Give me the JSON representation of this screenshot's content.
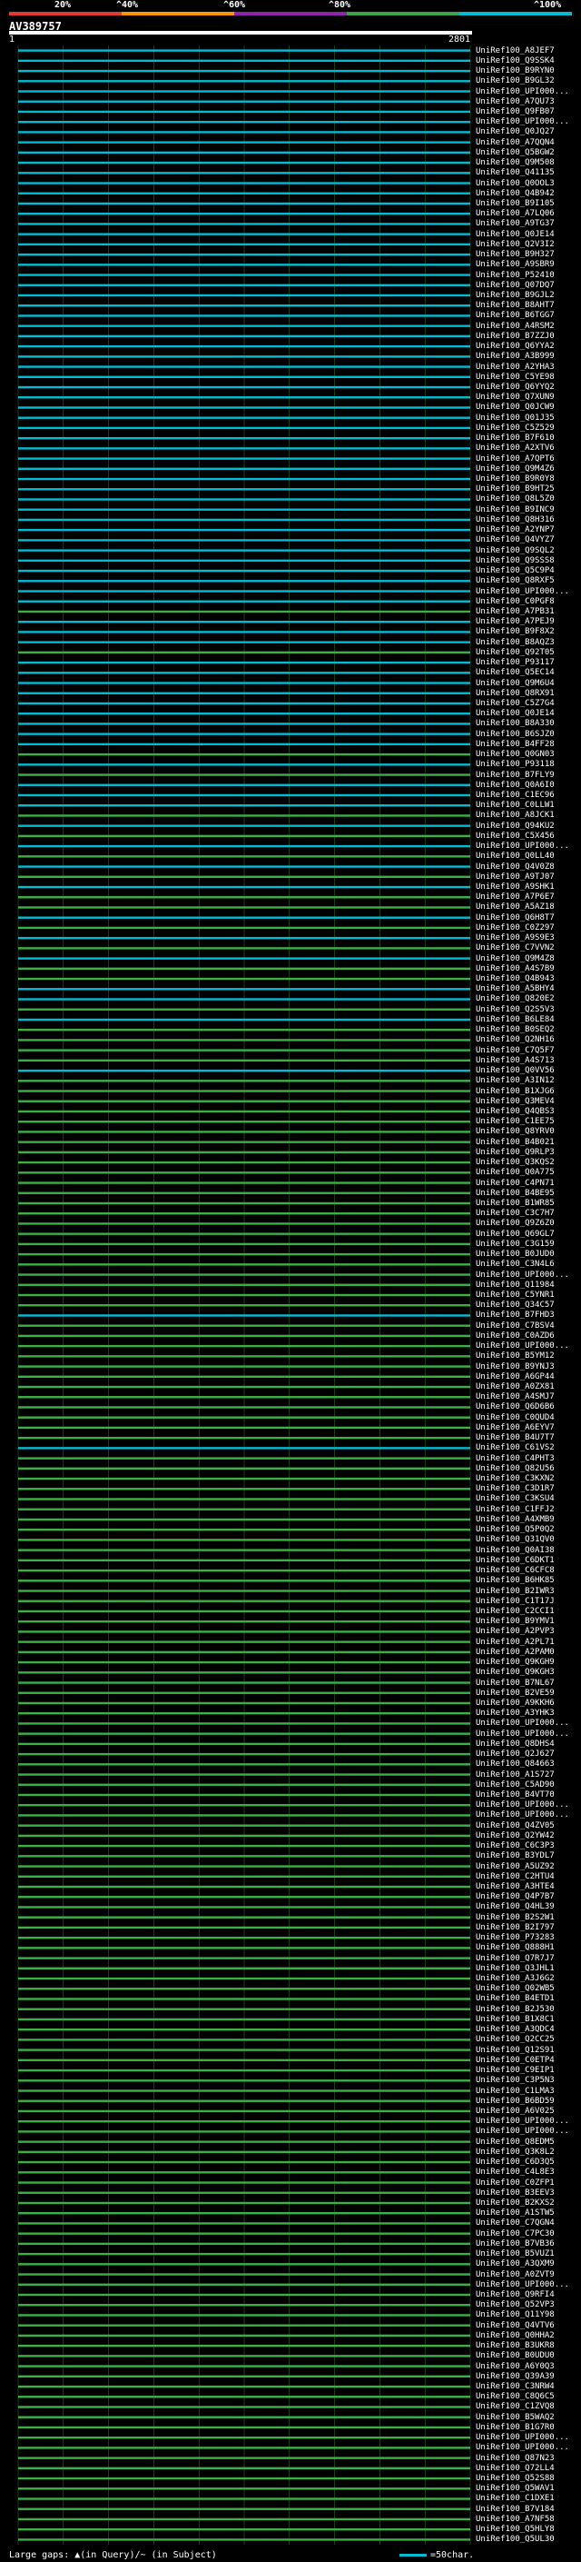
{
  "header": {
    "percent_labels": [
      "20%",
      "^40%",
      "^60%",
      "^80%",
      "^100%"
    ],
    "bands": [
      {
        "color": "#e53935"
      },
      {
        "color": "#ff9800"
      },
      {
        "color": "#8e24aa"
      },
      {
        "color": "#43a047"
      },
      {
        "color": "#00bcd4"
      }
    ]
  },
  "query": {
    "name": "AV389757",
    "start": "1",
    "end": "2801"
  },
  "footer": {
    "gaps_text": "Large gaps: ▲(in Query)/~ (in Subject)",
    "scale_text": "=50char."
  },
  "colors": {
    "cyan": "#00bcd4",
    "green": "#3cb043",
    "grid": "#2e7d32"
  },
  "chart_data": {
    "type": "alignment",
    "x_range": [
      1,
      2801
    ],
    "hits": [
      {
        "name": "UniRef100_A8JEF7",
        "cls": "c"
      },
      {
        "name": "UniRef100_Q9SSK4",
        "cls": "c"
      },
      {
        "name": "UniRef100_B9RYN0",
        "cls": "c"
      },
      {
        "name": "UniRef100_B9GL32",
        "cls": "c"
      },
      {
        "name": "UniRef100_UPI000...",
        "cls": "c"
      },
      {
        "name": "UniRef100_A7QU73",
        "cls": "c"
      },
      {
        "name": "UniRef100_Q9FB07",
        "cls": "c"
      },
      {
        "name": "UniRef100_UPI000...",
        "cls": "c"
      },
      {
        "name": "UniRef100_Q0JQ27",
        "cls": "c"
      },
      {
        "name": "UniRef100_A7QQN4",
        "cls": "c"
      },
      {
        "name": "UniRef100_Q5BGW2",
        "cls": "c"
      },
      {
        "name": "UniRef100_Q9M508",
        "cls": "c"
      },
      {
        "name": "UniRef100_Q41135",
        "cls": "c"
      },
      {
        "name": "UniRef100_Q0OOL3",
        "cls": "c"
      },
      {
        "name": "UniRef100_Q4B942",
        "cls": "c"
      },
      {
        "name": "UniRef100_B9I105",
        "cls": "c"
      },
      {
        "name": "UniRef100_A7LQ06",
        "cls": "c"
      },
      {
        "name": "UniRef100_A9TG37",
        "cls": "c"
      },
      {
        "name": "UniRef100_Q0JE14",
        "cls": "c"
      },
      {
        "name": "UniRef100_Q2V3I2",
        "cls": "c"
      },
      {
        "name": "UniRef100_B9H327",
        "cls": "c"
      },
      {
        "name": "UniRef100_A9SBR9",
        "cls": "c"
      },
      {
        "name": "UniRef100_P52410",
        "cls": "c"
      },
      {
        "name": "UniRef100_Q07DQ7",
        "cls": "c"
      },
      {
        "name": "UniRef100_B9GJL2",
        "cls": "c"
      },
      {
        "name": "UniRef100_B8AHT7",
        "cls": "c"
      },
      {
        "name": "UniRef100_B6TGG7",
        "cls": "c"
      },
      {
        "name": "UniRef100_A4RSM2",
        "cls": "c"
      },
      {
        "name": "UniRef100_B7ZZJ0",
        "cls": "c"
      },
      {
        "name": "UniRef100_Q6YYA2",
        "cls": "c"
      },
      {
        "name": "UniRef100_A3B999",
        "cls": "c"
      },
      {
        "name": "UniRef100_A2YHA3",
        "cls": "c"
      },
      {
        "name": "UniRef100_C5YE98",
        "cls": "c"
      },
      {
        "name": "UniRef100_Q6YYQ2",
        "cls": "c"
      },
      {
        "name": "UniRef100_Q7XUN9",
        "cls": "c"
      },
      {
        "name": "UniRef100_Q0JCW9",
        "cls": "c"
      },
      {
        "name": "UniRef100_Q01J35",
        "cls": "c"
      },
      {
        "name": "UniRef100_C5Z529",
        "cls": "c"
      },
      {
        "name": "UniRef100_B7F610",
        "cls": "c"
      },
      {
        "name": "UniRef100_A2XTV6",
        "cls": "c"
      },
      {
        "name": "UniRef100_A7QPT6",
        "cls": "c"
      },
      {
        "name": "UniRef100_Q9M4Z6",
        "cls": "c"
      },
      {
        "name": "UniRef100_B9R0Y8",
        "cls": "c"
      },
      {
        "name": "UniRef100_B9HT25",
        "cls": "c"
      },
      {
        "name": "UniRef100_Q8L5Z0",
        "cls": "c"
      },
      {
        "name": "UniRef100_B9INC9",
        "cls": "c"
      },
      {
        "name": "UniRef100_Q8H316",
        "cls": "c"
      },
      {
        "name": "UniRef100_A2YNP7",
        "cls": "c"
      },
      {
        "name": "UniRef100_Q4VYZ7",
        "cls": "c"
      },
      {
        "name": "UniRef100_Q9SQL2",
        "cls": "c"
      },
      {
        "name": "UniRef100_Q9SSS8",
        "cls": "c"
      },
      {
        "name": "UniRef100_Q5C9P4",
        "cls": "c"
      },
      {
        "name": "UniRef100_Q8RXF5",
        "cls": "c"
      },
      {
        "name": "UniRef100_UPI000...",
        "cls": "c"
      },
      {
        "name": "UniRef100_C0PGF8",
        "cls": "c"
      },
      {
        "name": "UniRef100_A7PB31",
        "cls": "g"
      },
      {
        "name": "UniRef100_A7PEJ9",
        "cls": "c"
      },
      {
        "name": "UniRef100_B9F8X2",
        "cls": "c"
      },
      {
        "name": "UniRef100_B8AQZ3",
        "cls": "c"
      },
      {
        "name": "UniRef100_Q92T05",
        "cls": "g"
      },
      {
        "name": "UniRef100_P93117",
        "cls": "c"
      },
      {
        "name": "UniRef100_Q5EC14",
        "cls": "c"
      },
      {
        "name": "UniRef100_Q9M6U4",
        "cls": "c"
      },
      {
        "name": "UniRef100_Q8RX91",
        "cls": "c"
      },
      {
        "name": "UniRef100_C5Z7G4",
        "cls": "c"
      },
      {
        "name": "UniRef100_Q0JE14",
        "cls": "c"
      },
      {
        "name": "UniRef100_B8A330",
        "cls": "c"
      },
      {
        "name": "UniRef100_B6SJZ0",
        "cls": "c"
      },
      {
        "name": "UniRef100_B4FF28",
        "cls": "c"
      },
      {
        "name": "UniRef100_Q0GN03",
        "cls": "g"
      },
      {
        "name": "UniRef100_P93118",
        "cls": "c"
      },
      {
        "name": "UniRef100_B7FLY9",
        "cls": "g"
      },
      {
        "name": "UniRef100_Q0A6I0",
        "cls": "c"
      },
      {
        "name": "UniRef100_C1EC96",
        "cls": "c"
      },
      {
        "name": "UniRef100_C0LLW1",
        "cls": "c"
      },
      {
        "name": "UniRef100_A8JCK1",
        "cls": "g"
      },
      {
        "name": "UniRef100_Q94KU2",
        "cls": "c"
      },
      {
        "name": "UniRef100_C5X456",
        "cls": "g"
      },
      {
        "name": "UniRef100_UPI000...",
        "cls": "c"
      },
      {
        "name": "UniRef100_Q0LL40",
        "cls": "g"
      },
      {
        "name": "UniRef100_Q4V0Z8",
        "cls": "c"
      },
      {
        "name": "UniRef100_A9TJ07",
        "cls": "g"
      },
      {
        "name": "UniRef100_A9SHK1",
        "cls": "c"
      },
      {
        "name": "UniRef100_A7P6E7",
        "cls": "g"
      },
      {
        "name": "UniRef100_A5AZ18",
        "cls": "g"
      },
      {
        "name": "UniRef100_Q6H8T7",
        "cls": "c"
      },
      {
        "name": "UniRef100_C0Z297",
        "cls": "g"
      },
      {
        "name": "UniRef100_A9S9E3",
        "cls": "c"
      },
      {
        "name": "UniRef100_C7VVN2",
        "cls": "g"
      },
      {
        "name": "UniRef100_Q9M4Z8",
        "cls": "c"
      },
      {
        "name": "UniRef100_A4S7B9",
        "cls": "g"
      },
      {
        "name": "UniRef100_Q4B943",
        "cls": "g"
      },
      {
        "name": "UniRef100_A5BHY4",
        "cls": "c"
      },
      {
        "name": "UniRef100_Q820E2",
        "cls": "c"
      },
      {
        "name": "UniRef100_Q2S5V3",
        "cls": "g"
      },
      {
        "name": "UniRef100_B6LE84",
        "cls": "c"
      },
      {
        "name": "UniRef100_B0SEQ2",
        "cls": "g"
      },
      {
        "name": "UniRef100_Q2NH16",
        "cls": "g"
      },
      {
        "name": "UniRef100_C7Q5F7",
        "cls": "g"
      },
      {
        "name": "UniRef100_A4S713",
        "cls": "g"
      },
      {
        "name": "UniRef100_Q0VV56",
        "cls": "c"
      },
      {
        "name": "UniRef100_A3IN12",
        "cls": "g"
      },
      {
        "name": "UniRef100_B1XJG6",
        "cls": "g"
      },
      {
        "name": "UniRef100_Q3MEV4",
        "cls": "g"
      },
      {
        "name": "UniRef100_Q4QBS3",
        "cls": "g"
      },
      {
        "name": "UniRef100_C1EE75",
        "cls": "g"
      },
      {
        "name": "UniRef100_Q8YRV0",
        "cls": "g"
      },
      {
        "name": "UniRef100_B4B021",
        "cls": "g"
      },
      {
        "name": "UniRef100_Q9RLP3",
        "cls": "g"
      },
      {
        "name": "UniRef100_Q3KQS2",
        "cls": "g"
      },
      {
        "name": "UniRef100_Q0A775",
        "cls": "g"
      },
      {
        "name": "UniRef100_C4PN71",
        "cls": "g"
      },
      {
        "name": "UniRef100_B4BE95",
        "cls": "g"
      },
      {
        "name": "UniRef100_B1WR85",
        "cls": "g"
      },
      {
        "name": "UniRef100_C3C7H7",
        "cls": "g"
      },
      {
        "name": "UniRef100_Q9Z6Z0",
        "cls": "g"
      },
      {
        "name": "UniRef100_Q69GL7",
        "cls": "g"
      },
      {
        "name": "UniRef100_C3G159",
        "cls": "g"
      },
      {
        "name": "UniRef100_B0JUD0",
        "cls": "g"
      },
      {
        "name": "UniRef100_C3N4L6",
        "cls": "g"
      },
      {
        "name": "UniRef100_UPI000...",
        "cls": "g"
      },
      {
        "name": "UniRef100_Q11984",
        "cls": "g"
      },
      {
        "name": "UniRef100_C5YNR1",
        "cls": "g"
      },
      {
        "name": "UniRef100_Q34C57",
        "cls": "g"
      },
      {
        "name": "UniRef100_B7FHD3",
        "cls": "c"
      },
      {
        "name": "UniRef100_C7BSV4",
        "cls": "g"
      },
      {
        "name": "UniRef100_C0AZD6",
        "cls": "g"
      },
      {
        "name": "UniRef100_UPI000...",
        "cls": "g"
      },
      {
        "name": "UniRef100_B5YM12",
        "cls": "g"
      },
      {
        "name": "UniRef100_B9YNJ3",
        "cls": "g"
      },
      {
        "name": "UniRef100_A6GP44",
        "cls": "g"
      },
      {
        "name": "UniRef100_A0ZX81",
        "cls": "g"
      },
      {
        "name": "UniRef100_A4SMJ7",
        "cls": "g"
      },
      {
        "name": "UniRef100_Q6D6B6",
        "cls": "g"
      },
      {
        "name": "UniRef100_C0QUD4",
        "cls": "g"
      },
      {
        "name": "UniRef100_A6EYV7",
        "cls": "g"
      },
      {
        "name": "UniRef100_B4U7T7",
        "cls": "g"
      },
      {
        "name": "UniRef100_C61VS2",
        "cls": "c"
      },
      {
        "name": "UniRef100_C4PHT3",
        "cls": "g"
      },
      {
        "name": "UniRef100_Q82U56",
        "cls": "g"
      },
      {
        "name": "UniRef100_C3KXN2",
        "cls": "g"
      },
      {
        "name": "UniRef100_C3D1R7",
        "cls": "g"
      },
      {
        "name": "UniRef100_C3KSU4",
        "cls": "g"
      },
      {
        "name": "UniRef100_C1FFJ2",
        "cls": "g"
      },
      {
        "name": "UniRef100_A4XMB9",
        "cls": "g"
      },
      {
        "name": "UniRef100_Q5P0Q2",
        "cls": "g"
      },
      {
        "name": "UniRef100_Q31QV0",
        "cls": "g"
      },
      {
        "name": "UniRef100_Q0AI38",
        "cls": "g"
      },
      {
        "name": "UniRef100_C6DKT1",
        "cls": "g"
      },
      {
        "name": "UniRef100_C6CFC8",
        "cls": "g"
      },
      {
        "name": "UniRef100_B6HK85",
        "cls": "g"
      },
      {
        "name": "UniRef100_B2IWR3",
        "cls": "g"
      },
      {
        "name": "UniRef100_C1T17J",
        "cls": "g"
      },
      {
        "name": "UniRef100_C2CCI1",
        "cls": "g"
      },
      {
        "name": "UniRef100_B9YMV1",
        "cls": "g"
      },
      {
        "name": "UniRef100_A2PVP3",
        "cls": "g"
      },
      {
        "name": "UniRef100_A2PL71",
        "cls": "g"
      },
      {
        "name": "UniRef100_A2PAM0",
        "cls": "g"
      },
      {
        "name": "UniRef100_Q9KGH9",
        "cls": "g"
      },
      {
        "name": "UniRef100_Q9KGH3",
        "cls": "g"
      },
      {
        "name": "UniRef100_B7NL67",
        "cls": "g"
      },
      {
        "name": "UniRef100_B2VE59",
        "cls": "g"
      },
      {
        "name": "UniRef100_A9KKH6",
        "cls": "g"
      },
      {
        "name": "UniRef100_A3YHK3",
        "cls": "g"
      },
      {
        "name": "UniRef100_UPI000...",
        "cls": "g"
      },
      {
        "name": "UniRef100_UPI000...",
        "cls": "g"
      },
      {
        "name": "UniRef100_Q8DHS4",
        "cls": "g"
      },
      {
        "name": "UniRef100_Q2J627",
        "cls": "g"
      },
      {
        "name": "UniRef100_Q84663",
        "cls": "g"
      },
      {
        "name": "UniRef100_A1S727",
        "cls": "g"
      },
      {
        "name": "UniRef100_C5AD90",
        "cls": "g"
      },
      {
        "name": "UniRef100_B4VT70",
        "cls": "g"
      },
      {
        "name": "UniRef100_UPI000...",
        "cls": "g"
      },
      {
        "name": "UniRef100_UPI000...",
        "cls": "g"
      },
      {
        "name": "UniRef100_Q4ZV05",
        "cls": "g"
      },
      {
        "name": "UniRef100_Q2YW42",
        "cls": "g"
      },
      {
        "name": "UniRef100_C6C3P3",
        "cls": "g"
      },
      {
        "name": "UniRef100_B3YDL7",
        "cls": "g"
      },
      {
        "name": "UniRef100_A5UZ92",
        "cls": "g"
      },
      {
        "name": "UniRef100_C2HTU4",
        "cls": "g"
      },
      {
        "name": "UniRef100_A3HTE4",
        "cls": "g"
      },
      {
        "name": "UniRef100_Q4P7B7",
        "cls": "g"
      },
      {
        "name": "UniRef100_Q4HL39",
        "cls": "g"
      },
      {
        "name": "UniRef100_B2S2W1",
        "cls": "g"
      },
      {
        "name": "UniRef100_B2I797",
        "cls": "g"
      },
      {
        "name": "UniRef100_P73283",
        "cls": "g"
      },
      {
        "name": "UniRef100_Q888H1",
        "cls": "g"
      },
      {
        "name": "UniRef100_Q7R7J7",
        "cls": "g"
      },
      {
        "name": "UniRef100_Q3JHL1",
        "cls": "g"
      },
      {
        "name": "UniRef100_A3J6G2",
        "cls": "g"
      },
      {
        "name": "UniRef100_Q02WB5",
        "cls": "g"
      },
      {
        "name": "UniRef100_B4ETD1",
        "cls": "g"
      },
      {
        "name": "UniRef100_B2J530",
        "cls": "g"
      },
      {
        "name": "UniRef100_B1X8C1",
        "cls": "g"
      },
      {
        "name": "UniRef100_A3QDC4",
        "cls": "g"
      },
      {
        "name": "UniRef100_Q2CC25",
        "cls": "g"
      },
      {
        "name": "UniRef100_Q12S91",
        "cls": "g"
      },
      {
        "name": "UniRef100_C0ETP4",
        "cls": "g"
      },
      {
        "name": "UniRef100_C9EIP1",
        "cls": "g"
      },
      {
        "name": "UniRef100_C3P5N3",
        "cls": "g"
      },
      {
        "name": "UniRef100_C1LMA3",
        "cls": "g"
      },
      {
        "name": "UniRef100_B6BD59",
        "cls": "g"
      },
      {
        "name": "UniRef100_A6V025",
        "cls": "g"
      },
      {
        "name": "UniRef100_UPI000...",
        "cls": "g"
      },
      {
        "name": "UniRef100_UPI000...",
        "cls": "g"
      },
      {
        "name": "UniRef100_Q8EDM5",
        "cls": "g"
      },
      {
        "name": "UniRef100_Q3K8L2",
        "cls": "g"
      },
      {
        "name": "UniRef100_C6D3Q5",
        "cls": "g"
      },
      {
        "name": "UniRef100_C4L8E3",
        "cls": "g"
      },
      {
        "name": "UniRef100_C0ZFP1",
        "cls": "g"
      },
      {
        "name": "UniRef100_B3EEV3",
        "cls": "g"
      },
      {
        "name": "UniRef100_B2KXS2",
        "cls": "g"
      },
      {
        "name": "UniRef100_A1STW5",
        "cls": "g"
      },
      {
        "name": "UniRef100_C7QGN4",
        "cls": "g"
      },
      {
        "name": "UniRef100_C7PC30",
        "cls": "g"
      },
      {
        "name": "UniRef100_B7VB36",
        "cls": "g"
      },
      {
        "name": "UniRef100_B5VUZ1",
        "cls": "g"
      },
      {
        "name": "UniRef100_A3QXM9",
        "cls": "g"
      },
      {
        "name": "UniRef100_A0ZVT9",
        "cls": "g"
      },
      {
        "name": "UniRef100_UPI000...",
        "cls": "g"
      },
      {
        "name": "UniRef100_Q9RFI4",
        "cls": "g"
      },
      {
        "name": "UniRef100_Q52VP3",
        "cls": "g"
      },
      {
        "name": "UniRef100_Q11Y98",
        "cls": "g"
      },
      {
        "name": "UniRef100_Q4VTV6",
        "cls": "g"
      },
      {
        "name": "UniRef100_Q0HHA2",
        "cls": "g"
      },
      {
        "name": "UniRef100_B3UKR8",
        "cls": "g"
      },
      {
        "name": "UniRef100_B0UDU0",
        "cls": "g"
      },
      {
        "name": "UniRef100_A6Y0Q3",
        "cls": "g"
      },
      {
        "name": "UniRef100_Q39A39",
        "cls": "g"
      },
      {
        "name": "UniRef100_C3NRW4",
        "cls": "g"
      },
      {
        "name": "UniRef100_C8Q6C5",
        "cls": "g"
      },
      {
        "name": "UniRef100_C1ZVQ8",
        "cls": "g"
      },
      {
        "name": "UniRef100_B5WAQ2",
        "cls": "g"
      },
      {
        "name": "UniRef100_B1G7R0",
        "cls": "g"
      },
      {
        "name": "UniRef100_UPI000...",
        "cls": "g"
      },
      {
        "name": "UniRef100_UPI000...",
        "cls": "g"
      },
      {
        "name": "UniRef100_Q87N23",
        "cls": "g"
      },
      {
        "name": "UniRef100_Q72LL4",
        "cls": "g"
      },
      {
        "name": "UniRef100_Q52S88",
        "cls": "g"
      },
      {
        "name": "UniRef100_Q5WAV1",
        "cls": "g"
      },
      {
        "name": "UniRef100_C1DXE1",
        "cls": "g"
      },
      {
        "name": "UniRef100_B7V184",
        "cls": "g"
      },
      {
        "name": "UniRef100_A7NF58",
        "cls": "g"
      },
      {
        "name": "UniRef100_Q5HLY8",
        "cls": "g"
      },
      {
        "name": "UniRef100_Q5UL30",
        "cls": "g"
      }
    ]
  }
}
